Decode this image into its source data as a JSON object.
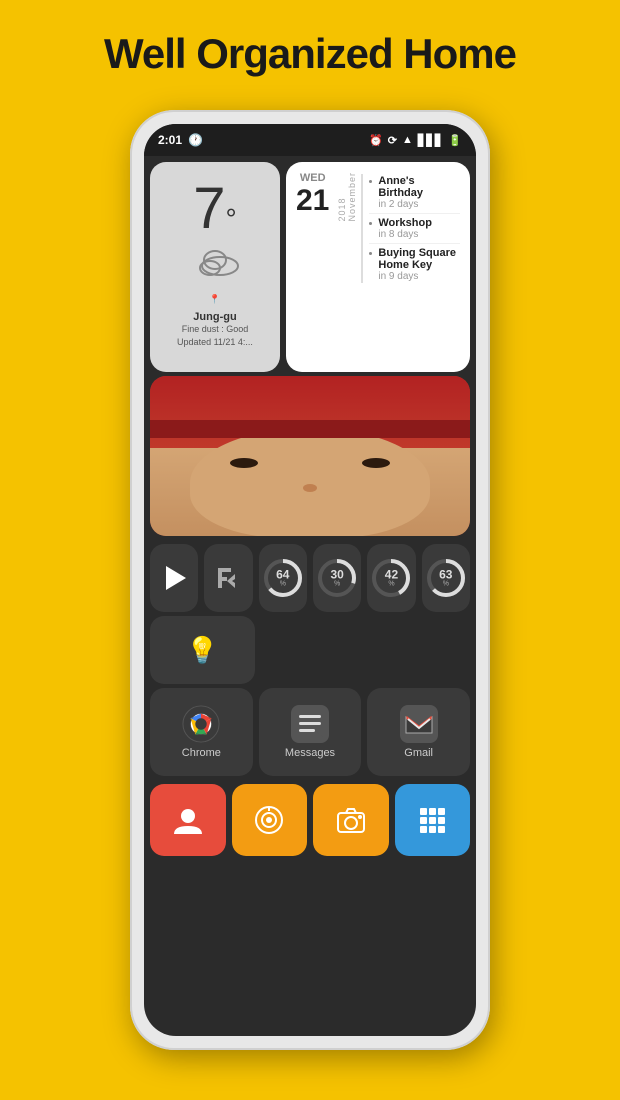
{
  "page": {
    "title": "Well Organized Home",
    "bg_color": "#F5C200"
  },
  "phone": {
    "status_bar": {
      "time": "2:01",
      "left_icons": [
        "alarm"
      ],
      "right_icons": [
        "alarm2",
        "sync",
        "wifi",
        "signal",
        "battery"
      ]
    },
    "weather": {
      "temp": "7",
      "unit": "°",
      "condition": "cloudy",
      "location": "Jung-gu",
      "dust": "Fine dust : Good",
      "updated": "Updated 11/21 4:..."
    },
    "calendar": {
      "weekday": "WED",
      "date": "21",
      "year_month": "2018 November",
      "events": [
        {
          "title": "Anne's Birthday",
          "time": "in 2 days"
        },
        {
          "title": "Workshop",
          "time": "in 8 days"
        },
        {
          "title": "Buying Square Home Key",
          "time": "in 9 days"
        }
      ]
    },
    "storage_widgets": [
      {
        "pct": 64,
        "color": "#e8e8e8"
      },
      {
        "pct": 30,
        "color": "#e8e8e8"
      },
      {
        "pct": 42,
        "color": "#e8e8e8"
      },
      {
        "pct": 63,
        "color": "#e8e8e8"
      }
    ],
    "apps": {
      "row1": [
        {
          "name": "Play Store",
          "icon": "play"
        },
        {
          "name": "FK",
          "icon": "fk"
        }
      ],
      "row2_bulb": {
        "name": "Bulb",
        "icon": "bulb"
      },
      "main": [
        {
          "name": "Chrome",
          "icon": "chrome"
        },
        {
          "name": "Messages",
          "icon": "messages"
        },
        {
          "name": "Gmail",
          "icon": "gmail"
        }
      ],
      "bottom": [
        {
          "name": "Contacts",
          "icon": "person",
          "color": "red"
        },
        {
          "name": "Camera360",
          "icon": "camera",
          "color": "yellow"
        },
        {
          "name": "Camera",
          "icon": "camera2",
          "color": "yellow"
        },
        {
          "name": "Grid",
          "icon": "grid",
          "color": "blue"
        }
      ]
    }
  }
}
